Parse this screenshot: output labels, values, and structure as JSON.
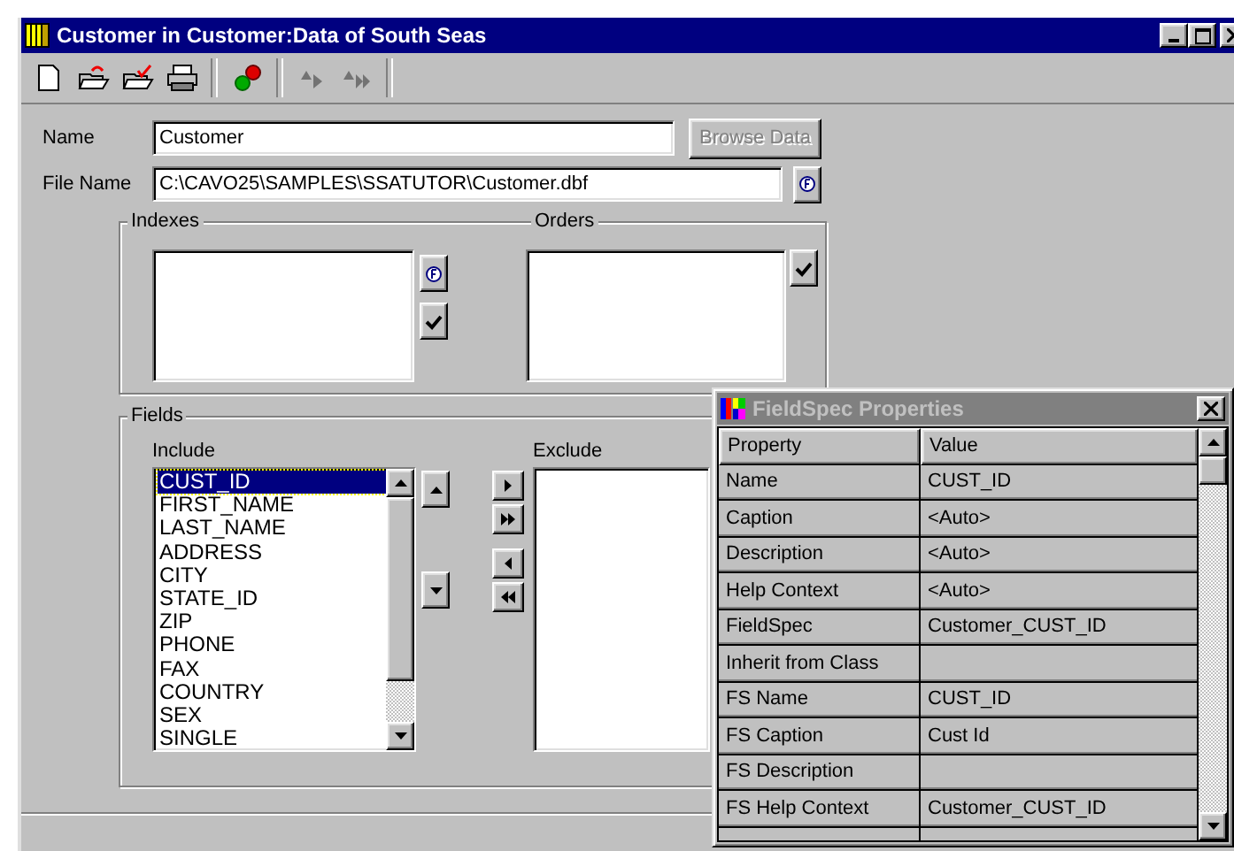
{
  "window": {
    "title": "Customer in Customer:Data of South Seas"
  },
  "toolbar": [
    {
      "kind": "new",
      "disabled": false
    },
    {
      "kind": "open",
      "disabled": false
    },
    {
      "kind": "open-check",
      "disabled": false
    },
    {
      "kind": "print",
      "disabled": false
    },
    {
      "kind": "separator"
    },
    {
      "kind": "balls",
      "disabled": false
    },
    {
      "kind": "separator"
    },
    {
      "kind": "forward",
      "disabled": true
    },
    {
      "kind": "forward-all",
      "disabled": true
    },
    {
      "kind": "separator"
    }
  ],
  "form": {
    "name": {
      "label": "Name",
      "value": "Customer"
    },
    "browse_button": {
      "label": "Browse Data",
      "disabled": true
    },
    "file_name": {
      "label": "File Name",
      "value": "C:\\CAVO25\\SAMPLES\\SSATUTOR\\Customer.dbf"
    },
    "indexes": {
      "label": "Indexes"
    },
    "orders": {
      "label": "Orders"
    },
    "fields": {
      "label": "Fields",
      "include": {
        "label": "Include",
        "items": [
          {
            "text": "CUST_ID",
            "selected": true
          },
          {
            "text": "FIRST_NAME",
            "selected": false
          },
          {
            "text": "LAST_NAME",
            "selected": false
          },
          {
            "text": "ADDRESS",
            "selected": false
          },
          {
            "text": "CITY",
            "selected": false
          },
          {
            "text": "STATE_ID",
            "selected": false
          },
          {
            "text": "ZIP",
            "selected": false
          },
          {
            "text": "PHONE",
            "selected": false
          },
          {
            "text": "FAX",
            "selected": false
          },
          {
            "text": "COUNTRY",
            "selected": false
          },
          {
            "text": "SEX",
            "selected": false
          },
          {
            "text": "SINGLE",
            "selected": false
          }
        ]
      },
      "exclude": {
        "label": "Exclude"
      }
    }
  },
  "palette": {
    "title": "FieldSpec Properties",
    "active": false,
    "columns": [
      "Property",
      "Value"
    ],
    "rows": [
      {
        "property": "Name",
        "value": "CUST_ID"
      },
      {
        "property": "Caption",
        "value": "<Auto>"
      },
      {
        "property": "Description",
        "value": "<Auto>"
      },
      {
        "property": "Help Context",
        "value": "<Auto>"
      },
      {
        "property": "FieldSpec",
        "value": "Customer_CUST_ID"
      },
      {
        "property": "Inherit from Class",
        "value": ""
      },
      {
        "property": "FS Name",
        "value": "CUST_ID"
      },
      {
        "property": "FS Caption",
        "value": "Cust Id"
      },
      {
        "property": "FS Description",
        "value": ""
      },
      {
        "property": "FS Help Context",
        "value": "Customer_CUST_ID"
      }
    ]
  }
}
